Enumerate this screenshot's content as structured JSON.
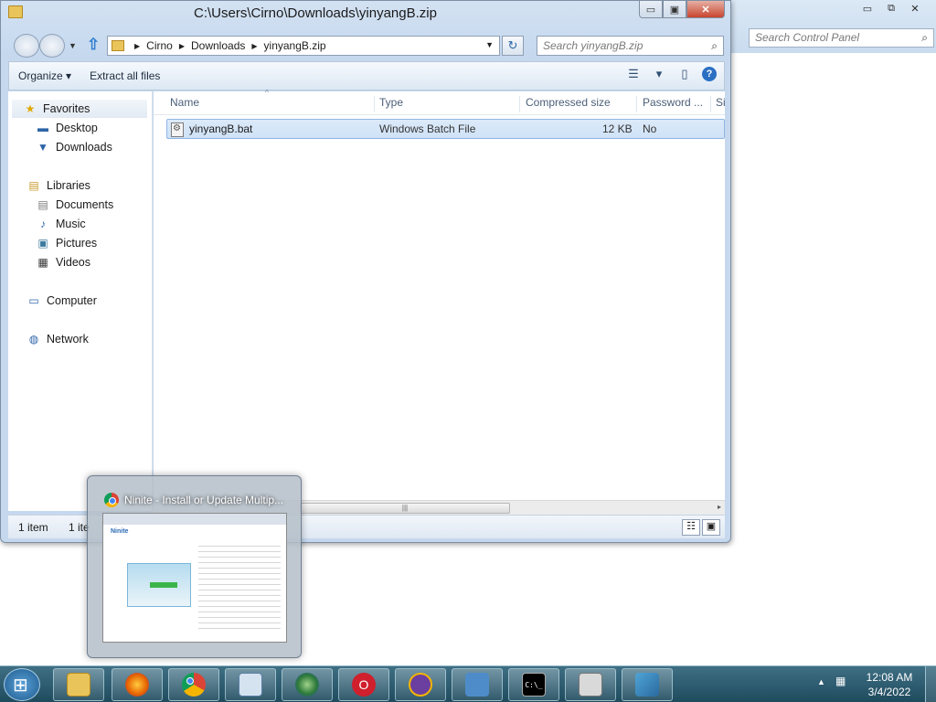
{
  "background_window": {
    "search_placeholder": "Search Control Panel",
    "min": "▭",
    "max": "⧉",
    "close": "✕"
  },
  "window": {
    "title": "C:\\Users\\Cirno\\Downloads\\yinyangB.zip",
    "min": "▭",
    "max": "▣",
    "close": "✕"
  },
  "address": {
    "crumbs": [
      "Cirno",
      "Downloads",
      "yinyangB.zip"
    ],
    "sep": "▶",
    "dropdown": "▼",
    "refresh": "↻"
  },
  "search": {
    "placeholder": "Search yinyangB.zip",
    "icon": "⌕"
  },
  "toolbar": {
    "organize": "Organize ▾",
    "extract": "Extract all files",
    "view_glyph": "☰",
    "view_drop": "▾",
    "pane_glyph": "▯",
    "help": "?"
  },
  "sidebar": {
    "favorites": "Favorites",
    "desktop": "Desktop",
    "downloads": "Downloads",
    "libraries": "Libraries",
    "documents": "Documents",
    "music": "Music",
    "pictures": "Pictures",
    "videos": "Videos",
    "computer": "Computer",
    "network": "Network",
    "icons": {
      "favorites": "★",
      "desktop": "▬",
      "downloads": "▼",
      "libraries": "▤",
      "documents": "▤",
      "music": "♪",
      "pictures": "▣",
      "videos": "▦",
      "computer": "▭",
      "network": "◍"
    }
  },
  "columns": [
    "Name",
    "Type",
    "Compressed size",
    "Password ...",
    "Si"
  ],
  "sort_caret": "^",
  "file": {
    "name": "yinyangB.bat",
    "type": "Windows Batch File",
    "size": "12 KB",
    "password": "No"
  },
  "scroll": {
    "grip": "|||",
    "arrow": "▸"
  },
  "status": {
    "left": "1 item",
    "right": "1 ite",
    "view1": "☷",
    "view2": "▣"
  },
  "thumbnail": {
    "title": "Ninite - Install or Update Multip...",
    "logo": "Ninite"
  },
  "taskbar": {
    "apps": [
      "explorer",
      "firefox",
      "chrome",
      "remote-desktop",
      "globe",
      "opera",
      "vpn",
      "control-panel",
      "cmd",
      "calculator",
      "registry"
    ],
    "cmd_label": "C:\\_",
    "clock_time": "12:08 AM",
    "clock_date": "3/4/2022",
    "tray_up": "▲",
    "tray_net": "▦"
  }
}
